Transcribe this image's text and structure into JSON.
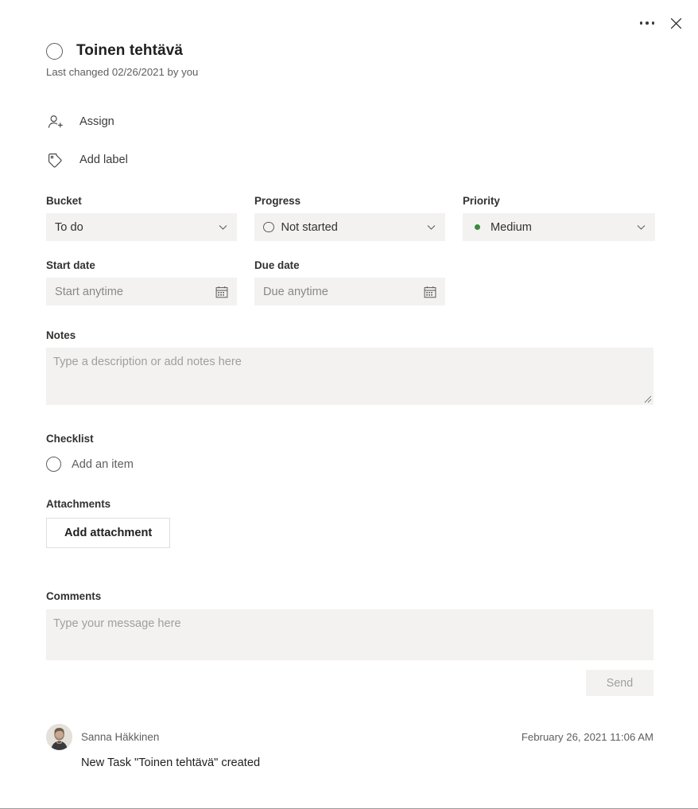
{
  "window": {
    "more_label": "More options",
    "close_label": "Close"
  },
  "task": {
    "title": "Toinen tehtävä",
    "completed": false,
    "last_changed": "Last changed 02/26/2021 by you"
  },
  "actions": [
    {
      "label": "Assign",
      "icon": "person-add-icon"
    },
    {
      "label": "Add label",
      "icon": "tag-icon"
    }
  ],
  "fields": {
    "bucket": {
      "label": "Bucket",
      "value": "To do"
    },
    "progress": {
      "label": "Progress",
      "value": "Not started"
    },
    "priority": {
      "label": "Priority",
      "value": "Medium",
      "dot_color": "#3a8a3a"
    },
    "start_date": {
      "label": "Start date",
      "placeholder": "Start anytime",
      "value": ""
    },
    "due_date": {
      "label": "Due date",
      "placeholder": "Due anytime",
      "value": ""
    }
  },
  "notes": {
    "label": "Notes",
    "placeholder": "Type a description or add notes here",
    "value": ""
  },
  "checklist": {
    "label": "Checklist",
    "add_item_placeholder": "Add an item"
  },
  "attachments": {
    "label": "Attachments",
    "add_button": "Add attachment"
  },
  "comments": {
    "label": "Comments",
    "placeholder": "Type your message here",
    "value": "",
    "send_label": "Send"
  },
  "activity": [
    {
      "author": "Sanna Häkkinen",
      "timestamp": "February 26, 2021 11:06 AM",
      "text": "New Task \"Toinen tehtävä\" created"
    }
  ]
}
